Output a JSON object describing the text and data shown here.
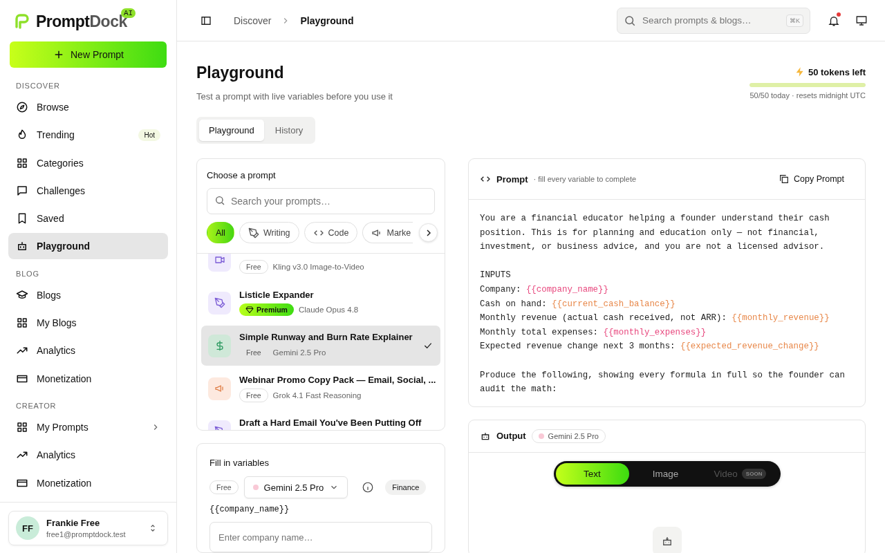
{
  "brand": {
    "name_a": "Prompt",
    "name_b": "Dock",
    "badge": "AI"
  },
  "new_prompt": {
    "label": "New Prompt"
  },
  "sidebar": {
    "sections": [
      {
        "title": "DISCOVER",
        "items": [
          {
            "label": "Browse",
            "kind": "compass",
            "selected": false
          },
          {
            "label": "Trending",
            "kind": "flame",
            "selected": false,
            "badge": "Hot"
          },
          {
            "label": "Categories",
            "kind": "grid",
            "selected": false
          },
          {
            "label": "Challenges",
            "kind": "chat",
            "selected": false
          },
          {
            "label": "Saved",
            "kind": "bookmark",
            "selected": false
          },
          {
            "label": "Playground",
            "kind": "robot",
            "selected": true
          }
        ]
      },
      {
        "title": "BLOG",
        "items": [
          {
            "label": "Blogs",
            "kind": "cap",
            "selected": false
          },
          {
            "label": "My Blogs",
            "kind": "grid",
            "selected": false
          },
          {
            "label": "Analytics",
            "kind": "trend",
            "selected": false
          },
          {
            "label": "Monetization",
            "kind": "card",
            "selected": false
          }
        ]
      },
      {
        "title": "CREATOR",
        "items": [
          {
            "label": "My Prompts",
            "kind": "grid",
            "selected": false,
            "chevron": true
          },
          {
            "label": "Analytics",
            "kind": "trend",
            "selected": false
          },
          {
            "label": "Monetization",
            "kind": "card",
            "selected": false
          }
        ]
      }
    ]
  },
  "user": {
    "initials": "FF",
    "name": "Frankie Free",
    "email": "free1@promptdock.test"
  },
  "breadcrumb": [
    {
      "label": "Discover",
      "current": false
    },
    {
      "label": "Playground",
      "current": true
    }
  ],
  "search": {
    "placeholder": "Search prompts & blogs…",
    "shortcut": "⌘K"
  },
  "notifications": {
    "unread": true
  },
  "page": {
    "title": "Playground",
    "subtitle": "Test a prompt with live variables before you use it"
  },
  "tokens": {
    "label": "50 tokens left",
    "level": 1,
    "note": "50/50 today · resets midnight UTC"
  },
  "tabs": [
    {
      "label": "Playground",
      "selected": true
    },
    {
      "label": "History",
      "selected": false
    }
  ],
  "chooser": {
    "title": "Choose a prompt",
    "placeholder": "Search your prompts…",
    "filters": [
      {
        "label": "All",
        "kind": "plain",
        "selected": true
      },
      {
        "label": "Writing",
        "kind": "pen",
        "selected": false
      },
      {
        "label": "Code",
        "kind": "code",
        "selected": false
      },
      {
        "label": "Marke",
        "kind": "megaphone",
        "selected": false
      }
    ],
    "items": [
      {
        "kind": "video",
        "badge": {
          "label": "Free",
          "kind": "free"
        },
        "model": "Kling v3.0 Image-to-Video",
        "selected": false
      },
      {
        "title": "Listicle Expander",
        "kind": "pen",
        "badge": {
          "label": "Premium",
          "kind": "premium"
        },
        "model": "Claude Opus 4.8",
        "selected": false
      },
      {
        "title": "Simple Runway and Burn Rate Explainer",
        "kind": "dollar",
        "badge": {
          "label": "Free",
          "kind": "free"
        },
        "model": "Gemini 2.5 Pro",
        "selected": true
      },
      {
        "title": "Webinar Promo Copy Pack — Email, Social, ...",
        "kind": "megaphone",
        "badge": {
          "label": "Free",
          "kind": "free"
        },
        "model": "Grok 4.1 Fast Reasoning",
        "selected": false
      },
      {
        "title": "Draft a Hard Email You've Been Putting Off",
        "kind": "pen",
        "selected": false
      }
    ]
  },
  "variables": {
    "title": "Fill in variables",
    "badge": "Free",
    "model": {
      "label": "Gemini 2.5 Pro",
      "color": "#f9c9d6"
    },
    "tag": "Finance",
    "fields": [
      {
        "label": "{{company_name}}",
        "placeholder": "Enter company name…"
      }
    ]
  },
  "prompt": {
    "title": "Prompt",
    "hint": "· fill every variable to complete",
    "copy": "Copy Prompt",
    "paragraphs": [
      [
        {
          "text": "You are a financial educator helping a founder understand their cash"
        },
        {
          "text": "position. This is for planning and education only — not financial,"
        },
        {
          "text": "investment, or business advice, and you are not a licensed advisor."
        }
      ],
      [
        {
          "text": "INPUTS"
        },
        {
          "text": "Company: ",
          "variable": "{{company_name}}",
          "color": "#e8487e"
        },
        {
          "text": "Cash on hand: ",
          "variable": "{{current_cash_balance}}",
          "color": "#e8884a"
        },
        {
          "text": "Monthly revenue (actual cash received, not ARR): ",
          "variable": "{{monthly_revenue}}",
          "color": "#e8884a"
        },
        {
          "text": "Monthly total expenses: ",
          "variable": "{{monthly_expenses}}",
          "color": "#e8487e"
        },
        {
          "text": "Expected revenue change next 3 months: ",
          "variable": "{{expected_revenue_change}}",
          "color": "#e8884a"
        }
      ],
      [
        {
          "text": "Produce the following, showing every formula in full so the founder can"
        },
        {
          "text": "audit the math:"
        }
      ]
    ]
  },
  "output": {
    "title": "Output",
    "model": {
      "label": "Gemini 2.5 Pro",
      "color": "#f9c9d6"
    },
    "modes": [
      {
        "label": "Text",
        "selected": true,
        "disabled": false
      },
      {
        "label": "Image",
        "selected": false,
        "disabled": false
      },
      {
        "label": "Video",
        "selected": false,
        "disabled": true,
        "badge": "SOON"
      }
    ]
  }
}
